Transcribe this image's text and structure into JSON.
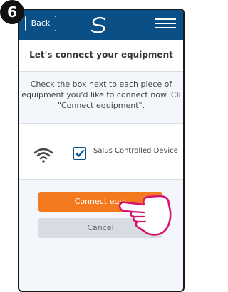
{
  "step_number": "6",
  "header": {
    "back_label": "Back",
    "logo": "salus-logo-icon",
    "menu": "hamburger-menu-icon",
    "bar_color": "#0a4f86"
  },
  "page": {
    "title": "Let's connect your equipment"
  },
  "instructions": "Check the box next to each piece of\nequipment you'd like to connect now. Cli\n\"Connect equipment\".",
  "device": {
    "name": "Salus Controlled Device",
    "checked": true,
    "icon": "wifi-icon"
  },
  "buttons": {
    "connect_label": "Connect equi",
    "cancel_label": "Cancel",
    "connect_color": "#f47a1f"
  },
  "overlay": {
    "hand_icon": "pointing-hand-icon",
    "hand_color": "#d6136e"
  }
}
